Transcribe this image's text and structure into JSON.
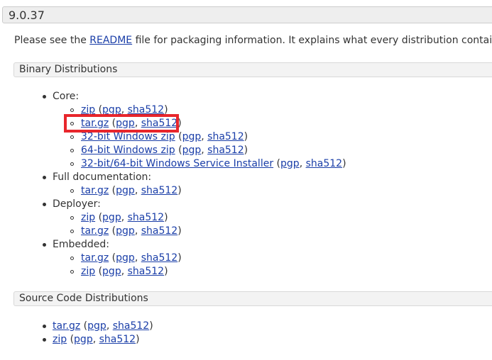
{
  "page": {
    "version_title": "9.0.37",
    "intro": {
      "before": "Please see the ",
      "link": "README",
      "after": " file for packaging information. It explains what every distribution contains."
    }
  },
  "binary": {
    "heading": "Binary Distributions",
    "groups": [
      {
        "label": "Core:",
        "items": [
          {
            "link": "zip",
            "pgp": "pgp",
            "sha": "sha512"
          },
          {
            "link": "tar.gz",
            "pgp": "pgp",
            "sha": "sha512"
          },
          {
            "link": "32-bit Windows zip",
            "pgp": "pgp",
            "sha": "sha512"
          },
          {
            "link": "64-bit Windows zip",
            "pgp": "pgp",
            "sha": "sha512"
          },
          {
            "link": "32-bit/64-bit Windows Service Installer",
            "pgp": "pgp",
            "sha": "sha512"
          }
        ]
      },
      {
        "label": "Full documentation:",
        "items": [
          {
            "link": "tar.gz",
            "pgp": "pgp",
            "sha": "sha512"
          }
        ]
      },
      {
        "label": "Deployer:",
        "items": [
          {
            "link": "zip",
            "pgp": "pgp",
            "sha": "sha512"
          },
          {
            "link": "tar.gz",
            "pgp": "pgp",
            "sha": "sha512"
          }
        ]
      },
      {
        "label": "Embedded:",
        "items": [
          {
            "link": "tar.gz",
            "pgp": "pgp",
            "sha": "sha512"
          },
          {
            "link": "zip",
            "pgp": "pgp",
            "sha": "sha512"
          }
        ]
      }
    ]
  },
  "source": {
    "heading": "Source Code Distributions",
    "items": [
      {
        "link": "tar.gz",
        "pgp": "pgp",
        "sha": "sha512"
      },
      {
        "link": "zip",
        "pgp": "pgp",
        "sha": "sha512"
      }
    ]
  },
  "punct": {
    "open": " (",
    "sep": ", ",
    "close": ")"
  },
  "colors": {
    "link": "#1a3ea8",
    "highlight": "#e8262c",
    "title_bg": "#eeeeee",
    "section_bg": "#f3f3f3"
  }
}
